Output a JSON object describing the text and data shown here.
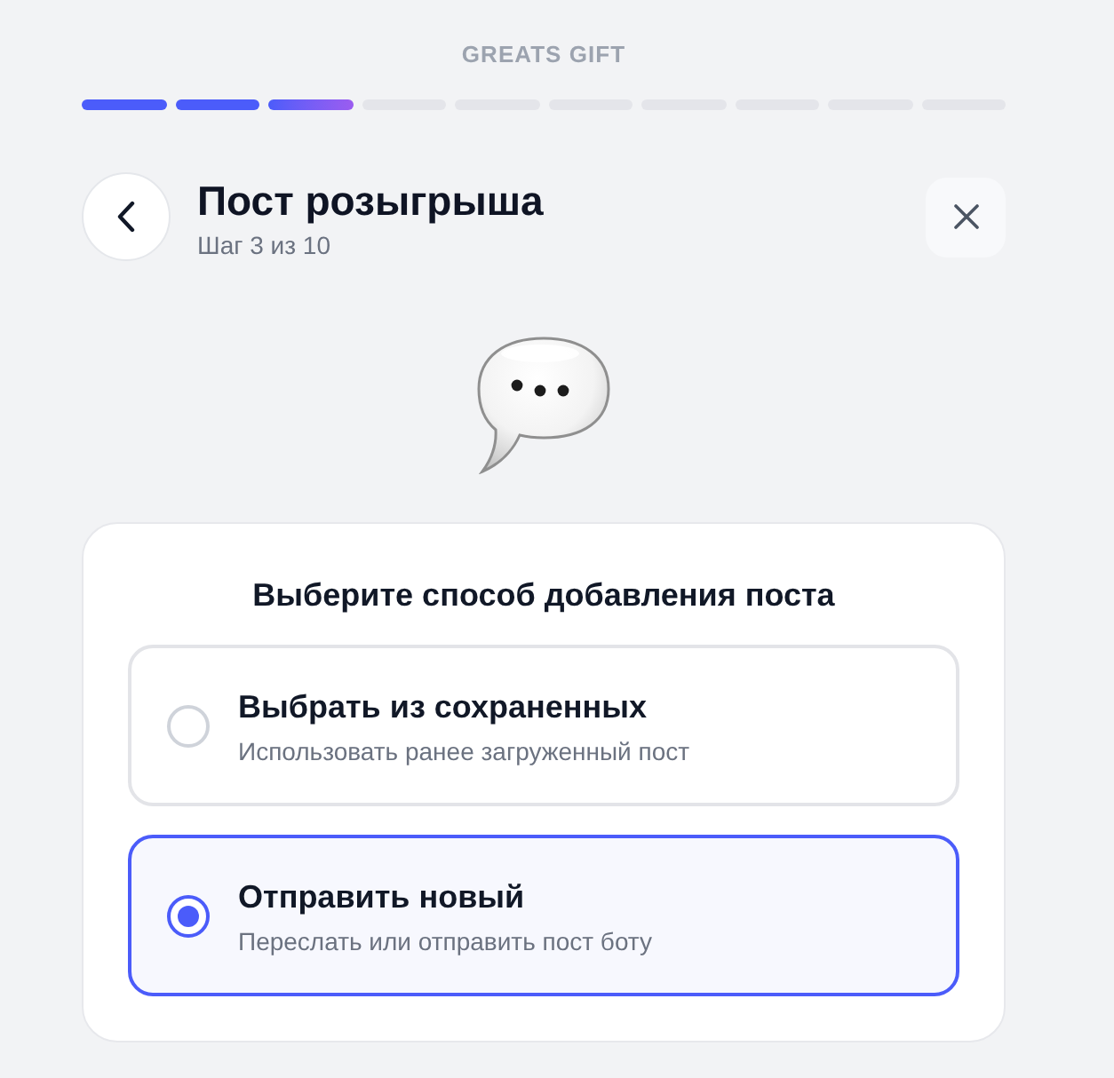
{
  "brand": "GREATS GIFT",
  "progress": {
    "segments": [
      {
        "kind": "done"
      },
      {
        "kind": "done"
      },
      {
        "kind": "current"
      },
      {
        "kind": "pending"
      },
      {
        "kind": "pending"
      },
      {
        "kind": "pending"
      },
      {
        "kind": "pending"
      },
      {
        "kind": "pending"
      },
      {
        "kind": "pending"
      },
      {
        "kind": "pending"
      }
    ]
  },
  "header": {
    "title": "Пост розыгрыша",
    "subtitle": "Шаг 3 из 10"
  },
  "card": {
    "heading": "Выберите способ добавления поста",
    "options": [
      {
        "title": "Выбрать из сохраненных",
        "description": "Использовать ранее загруженный пост",
        "selected": false
      },
      {
        "title": "Отправить новый",
        "description": "Переслать или отправить пост боту",
        "selected": true
      }
    ]
  }
}
